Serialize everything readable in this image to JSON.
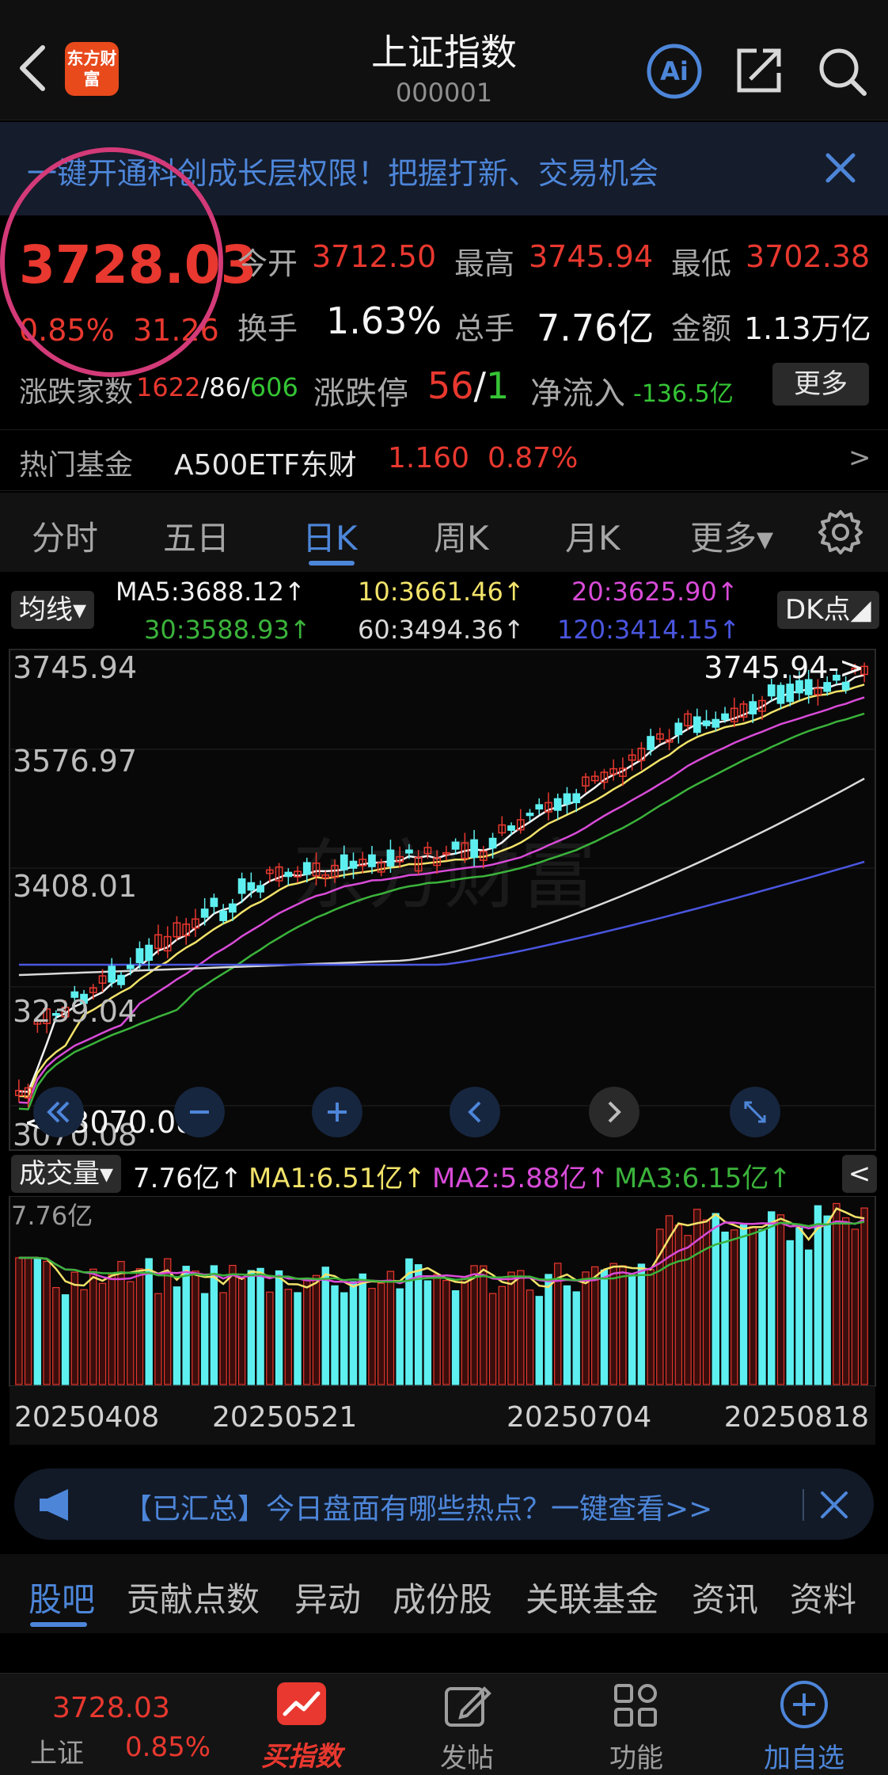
{
  "header": {
    "title": "上证指数",
    "code": "000001",
    "logo_text": "东方财富",
    "ai_label": "Ai"
  },
  "banner": {
    "text": "一键开通科创成长层权限！把握打新、交易机会"
  },
  "quote": {
    "price": "3728.03",
    "change_pct": "0.85%",
    "change_abs": "31.26",
    "open_label": "今开",
    "open": "3712.50",
    "high_label": "最高",
    "high": "3745.94",
    "low_label": "最低",
    "low": "3702.38",
    "turnover_label": "换手",
    "turnover": "1.63%",
    "volume_label": "总手",
    "volume": "7.76亿",
    "amount_label": "金额",
    "amount": "1.13万亿",
    "breadth_label": "涨跌家数",
    "breadth_up": "1622",
    "breadth_flat": "86",
    "breadth_down": "606",
    "limit_label": "涨跌停",
    "limit_up": "56",
    "limit_down": "1",
    "netflow_label": "净流入",
    "netflow": "-136.5亿",
    "more_label": "更多"
  },
  "fund": {
    "label": "热门基金",
    "name": "A500ETF东财",
    "price": "1.160",
    "pct": "0.87%",
    "arrow": ">"
  },
  "tabs": [
    {
      "label": "分时",
      "active": false
    },
    {
      "label": "五日",
      "active": false
    },
    {
      "label": "日K",
      "active": true
    },
    {
      "label": "周K",
      "active": false
    },
    {
      "label": "月K",
      "active": false
    },
    {
      "label": "更多▾",
      "active": false
    }
  ],
  "ma": {
    "selector": "均线▾",
    "ma5": "MA5:3688.12↑",
    "ma10": "10:3661.46↑",
    "ma20": "20:3625.90↑",
    "ma30": "30:3588.93↑",
    "ma60": "60:3494.36↑",
    "ma120": "120:3414.15↑",
    "dk": "DK点◢"
  },
  "kline": {
    "y_labels": [
      "3745.94",
      "3576.97",
      "3408.01",
      "3239.04",
      "3070.08"
    ],
    "high_marker": "3745.94->",
    "low_marker": "<--3070.08",
    "x_labels": [
      "20250408",
      "20250521",
      "20250704",
      "20250818"
    ],
    "watermark": "东方财富"
  },
  "volume": {
    "selector": "成交量▾",
    "value": "7.76亿↑",
    "ma1": "MA1:6.51亿↑",
    "ma2": "MA2:5.88亿↑",
    "ma3": "MA3:6.15亿↑",
    "axis_label": "7.76亿",
    "collapse": "<"
  },
  "notice": {
    "text": "【已汇总】今日盘面有哪些热点？一键查看>>"
  },
  "bottom_tabs": [
    {
      "label": "股吧",
      "active": true
    },
    {
      "label": "贡献点数",
      "active": false
    },
    {
      "label": "异动",
      "active": false
    },
    {
      "label": "成份股",
      "active": false
    },
    {
      "label": "关联基金",
      "active": false
    },
    {
      "label": "资讯",
      "active": false
    },
    {
      "label": "资料",
      "active": false
    }
  ],
  "footer": {
    "index_price": "3728.03",
    "index_name": "上证",
    "index_pct": "0.85%",
    "buy_label": "买指数",
    "post_label": "发帖",
    "func_label": "功能",
    "add_label": "加自选"
  },
  "colors": {
    "up": "#e8382f",
    "down": "#5ef0f0",
    "accent": "#4d86d9"
  }
}
